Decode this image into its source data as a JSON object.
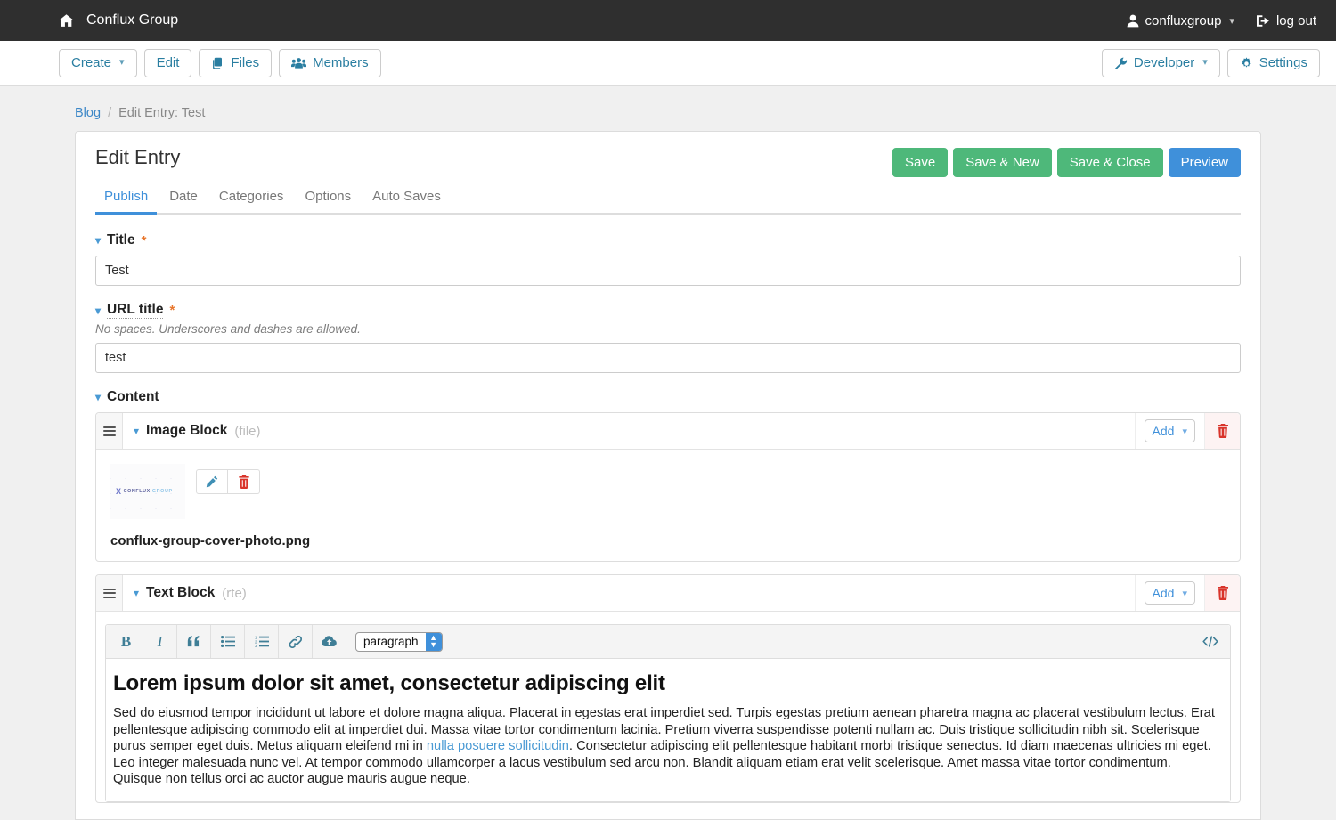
{
  "topbar": {
    "home_icon": "home-icon",
    "site_name": "Conflux Group",
    "account_label": "confluxgroup",
    "account_icon": "user-icon",
    "logout_label": "log out",
    "logout_icon": "logout-icon"
  },
  "navbar": {
    "left_buttons": [
      {
        "label": "Create",
        "icon": "",
        "caret": true
      },
      {
        "label": "Edit",
        "icon": "",
        "caret": false
      },
      {
        "label": "Files",
        "icon": "files-icon",
        "caret": false
      },
      {
        "label": "Members",
        "icon": "members-icon",
        "caret": false
      }
    ],
    "right_buttons": [
      {
        "label": "Developer",
        "icon": "wrench-icon",
        "caret": true
      },
      {
        "label": "Settings",
        "icon": "gear-icon",
        "caret": false
      }
    ]
  },
  "breadcrumb": {
    "root": "Blog",
    "separator": "/",
    "current": "Edit Entry: Test"
  },
  "page": {
    "title": "Edit Entry",
    "actions": [
      {
        "label": "Save",
        "style": "green"
      },
      {
        "label": "Save & New",
        "style": "green"
      },
      {
        "label": "Save & Close",
        "style": "green"
      },
      {
        "label": "Preview",
        "style": "blue"
      }
    ],
    "tabs": [
      {
        "label": "Publish",
        "active": true
      },
      {
        "label": "Date",
        "active": false
      },
      {
        "label": "Categories",
        "active": false
      },
      {
        "label": "Options",
        "active": false
      },
      {
        "label": "Auto Saves",
        "active": false
      }
    ]
  },
  "fields": {
    "title": {
      "label": "Title",
      "required_mark": "*",
      "value": "Test"
    },
    "url_title": {
      "label": "URL title",
      "required_mark": "*",
      "hint": "No spaces. Underscores and dashes are allowed.",
      "value": "test"
    },
    "content": {
      "label": "Content"
    }
  },
  "blocks": [
    {
      "name": "Image Block",
      "type": "(file)",
      "add_label": "Add",
      "file_name": "conflux-group-cover-photo.png",
      "thumb_logo": {
        "mark": "X",
        "part_a": "CONFLUX",
        "part_b": "GROUP"
      },
      "edit_icon": "pencil-icon",
      "delete_icon": "trash-icon"
    },
    {
      "name": "Text Block",
      "type": "(rte)",
      "add_label": "Add",
      "delete_icon": "trash-icon"
    }
  ],
  "rte": {
    "toolbar": [
      {
        "name": "bold-icon",
        "glyph": "B"
      },
      {
        "name": "italic-icon",
        "glyph": "I"
      },
      {
        "name": "blockquote-icon",
        "glyph": "”"
      },
      {
        "name": "unordered-list-icon",
        "glyph": ""
      },
      {
        "name": "ordered-list-icon",
        "glyph": ""
      },
      {
        "name": "link-icon",
        "glyph": ""
      },
      {
        "name": "upload-cloud-icon",
        "glyph": ""
      }
    ],
    "format_select": {
      "value": "paragraph"
    },
    "source_icon": "code-icon",
    "heading": "Lorem ipsum dolor sit amet, consectetur adipiscing elit",
    "body_before_link": "Sed do eiusmod tempor incididunt ut labore et dolore magna aliqua. Placerat in egestas erat imperdiet sed. Turpis egestas pretium aenean pharetra magna ac placerat vestibulum lectus. Erat pellentesque adipiscing commodo elit at imperdiet dui. Massa vitae tortor condimentum lacinia. Pretium viverra suspendisse potenti nullam ac. Duis tristique sollicitudin nibh sit. Scelerisque purus semper eget duis. Metus aliquam eleifend mi in ",
    "body_link": "nulla posuere sollicitudin",
    "body_after_link": ". Consectetur adipiscing elit pellentesque habitant morbi tristique senectus. Id diam maecenas ultricies mi eget. Leo integer malesuada nunc vel. At tempor commodo ullamcorper a lacus vestibulum sed arcu non. Blandit aliquam etiam erat velit scelerisque. Amet massa vitae tortor condimentum. Quisque non tellus orci ac auctor augue mauris augue neque."
  },
  "colors": {
    "topbar_bg": "#2f2f2f",
    "link": "#3f90da",
    "accent_green": "#4eb87a",
    "required": "#e8762c",
    "danger": "#d9534f"
  }
}
